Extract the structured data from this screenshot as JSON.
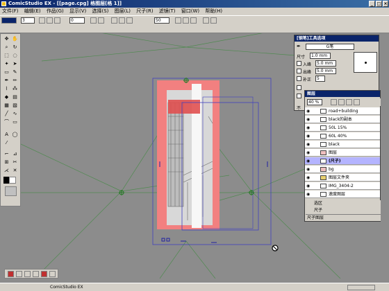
{
  "window": {
    "title": "ComicStudio EX - [[page.cpg] 格图层[格 1]]"
  },
  "menu": [
    "文件(F)",
    "编辑(E)",
    "作品(G)",
    "显示(V)",
    "选择(S)",
    "图层(L)",
    "尺子(R)",
    "滤镜(T)",
    "窗口(W)",
    "帮助(H)"
  ],
  "toolbar": {
    "brush_size": "3",
    "zoom": "0",
    "opacity": "50"
  },
  "pen_panel": {
    "title": "[钢笔]工具选项",
    "preset": "G笔",
    "size_label": "尺寸",
    "size_value": "1.0 mm",
    "in_label": "入峰",
    "in_value": "5.0 mm",
    "out_label": "出峰",
    "out_value": "5.0 mm",
    "correction_label": "补正",
    "correction_value": "5",
    "footer_label": "不"
  },
  "layer_panel": {
    "title": "图层",
    "opacity": "40 %",
    "layers": [
      {
        "name": "road+building"
      },
      {
        "name": "black的副本"
      },
      {
        "name": "50L 15%"
      },
      {
        "name": "60L 40%"
      },
      {
        "name": "black"
      },
      {
        "name": "图层"
      },
      {
        "name": "(尺子)"
      },
      {
        "name": "bg"
      },
      {
        "name": "图层文件夹"
      },
      {
        "name": "IMG_3404-2"
      },
      {
        "name": "速度图层"
      }
    ],
    "footer_selection": "选区",
    "footer_ruler": "尺子",
    "footer_tab": "尺子图层"
  },
  "status": {
    "app": "ComicStudio EX"
  },
  "colors": {
    "title_bar": "#0a246a",
    "selection": "#b4b4ff",
    "panel_bg": "#d4d0c8"
  }
}
